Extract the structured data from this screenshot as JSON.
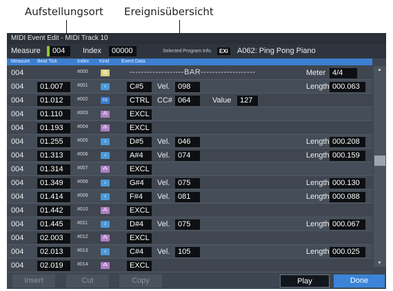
{
  "callouts": {
    "left": "Aufstellungsort",
    "right": "Ereignisübersicht"
  },
  "window": {
    "title": "MIDI Event Edit - MIDI Track 10"
  },
  "measure_bar": {
    "measure_label": "Measure",
    "measure_value": "004",
    "index_label": "Index",
    "index_value": "00000",
    "selected_label": "Selected Program Info.",
    "program_tag": "EXi",
    "program_name": "A062: Ping Pong Piano"
  },
  "headers": {
    "measure": "Measure",
    "beat_tick": "Beat Tick",
    "index": "Index",
    "kind": "Kind",
    "event_data": "Event Data"
  },
  "colors": {
    "panel": "#3e4651",
    "header": "#3c7fd1",
    "note_kind": "#4a9ad8",
    "excl_kind": "#b07ec4",
    "bar_kind": "#d8cf7a",
    "done_button": "#3c84d8"
  },
  "rows": [
    {
      "measure": "004",
      "tick": "",
      "index": "#000",
      "kind": "bar",
      "type": "bar",
      "bar_text": "-------------------BAR-------------------",
      "meter_label": "Meter",
      "meter_value": "4/4"
    },
    {
      "measure": "004",
      "tick": "01.007",
      "index": "#001",
      "kind": "note",
      "type": "note",
      "event": "C#5",
      "vel_label": "Vel.",
      "vel": "098",
      "len_label": "Length",
      "len": "000.063"
    },
    {
      "measure": "004",
      "tick": "01.012",
      "index": "#002",
      "kind": "cc",
      "type": "ctrl",
      "event": "CTRL",
      "cc_label": "CC#",
      "cc": "064",
      "value_label": "Value",
      "value": "127"
    },
    {
      "measure": "004",
      "tick": "01.110",
      "index": "#003",
      "kind": "excl",
      "type": "excl",
      "event": "EXCL"
    },
    {
      "measure": "004",
      "tick": "01.193",
      "index": "#004",
      "kind": "excl",
      "type": "excl",
      "event": "EXCL"
    },
    {
      "measure": "004",
      "tick": "01.255",
      "index": "#005",
      "kind": "note",
      "type": "note",
      "event": "D#5",
      "vel_label": "Vel.",
      "vel": "046",
      "len_label": "Length",
      "len": "000.208"
    },
    {
      "measure": "004",
      "tick": "01.313",
      "index": "#006",
      "kind": "note",
      "type": "note",
      "event": "A#4",
      "vel_label": "Vel.",
      "vel": "074",
      "len_label": "Length",
      "len": "000.159"
    },
    {
      "measure": "004",
      "tick": "01.314",
      "index": "#007",
      "kind": "excl",
      "type": "excl",
      "event": "EXCL"
    },
    {
      "measure": "004",
      "tick": "01.349",
      "index": "#008",
      "kind": "note",
      "type": "note",
      "event": "G#4",
      "vel_label": "Vel.",
      "vel": "075",
      "len_label": "Length",
      "len": "000.130"
    },
    {
      "measure": "004",
      "tick": "01.414",
      "index": "#009",
      "kind": "note",
      "type": "note",
      "event": "F#4",
      "vel_label": "Vel.",
      "vel": "081",
      "len_label": "Length",
      "len": "000.088"
    },
    {
      "measure": "004",
      "tick": "01.442",
      "index": "#010",
      "kind": "excl",
      "type": "excl",
      "event": "EXCL"
    },
    {
      "measure": "004",
      "tick": "01.445",
      "index": "#011",
      "kind": "note",
      "type": "note",
      "event": "D#4",
      "vel_label": "Vel.",
      "vel": "075",
      "len_label": "Length",
      "len": "000.067"
    },
    {
      "measure": "004",
      "tick": "02.003",
      "index": "#012",
      "kind": "excl",
      "type": "excl",
      "event": "EXCL"
    },
    {
      "measure": "004",
      "tick": "02.013",
      "index": "#013",
      "kind": "note",
      "type": "note",
      "event": "C#4",
      "vel_label": "Vel.",
      "vel": "105",
      "len_label": "Length",
      "len": "000.025"
    },
    {
      "measure": "004",
      "tick": "02.019",
      "index": "#014",
      "kind": "excl",
      "type": "excl",
      "event": "EXCL"
    }
  ],
  "buttons": {
    "insert": "Insert",
    "cut": "Cut",
    "copy": "Copy",
    "play": "Play",
    "done": "Done"
  },
  "scrollbar": {
    "up_icon": "▲",
    "down_icon": "▼"
  }
}
